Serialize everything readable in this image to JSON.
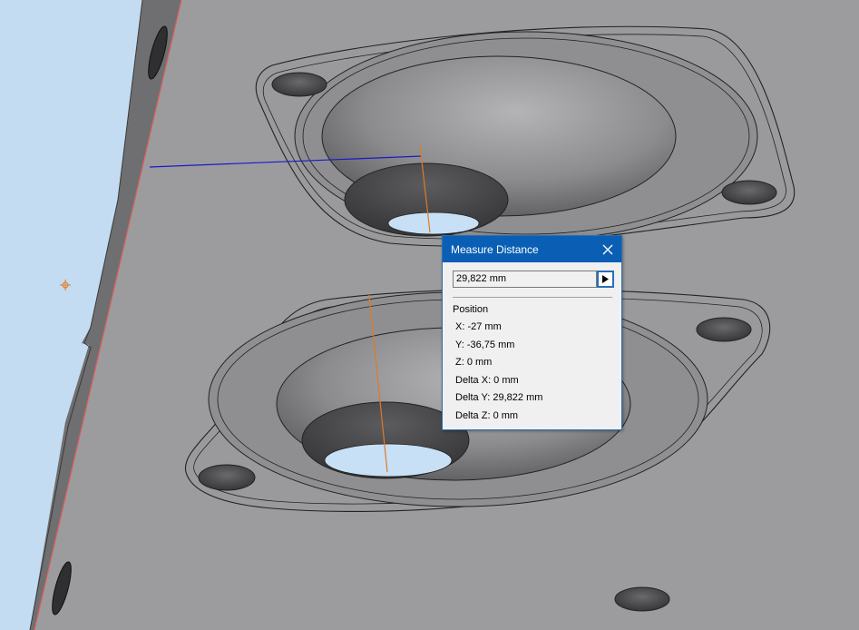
{
  "dialog": {
    "title": "Measure Distance",
    "value": "29,822 mm",
    "section_label": "Position",
    "rows": [
      "X: -27 mm",
      "Y: -36,75 mm",
      "Z: 0 mm",
      "Delta X: 0 mm",
      "Delta Y: 29,822 mm",
      "Delta Z: 0 mm"
    ]
  },
  "icons": {
    "close": "close-icon",
    "arrow": "play-arrow-icon",
    "origin": "origin-marker-icon"
  },
  "colors": {
    "background": "#c3dcf2",
    "part_face": "#9a9a9c",
    "part_side": "#6e6e70",
    "titlebar": "#0a5fb4",
    "measure_line_blue": "#1a1acc",
    "measure_line_orange": "#e07a20",
    "silhouette_edge": "#e06060"
  }
}
